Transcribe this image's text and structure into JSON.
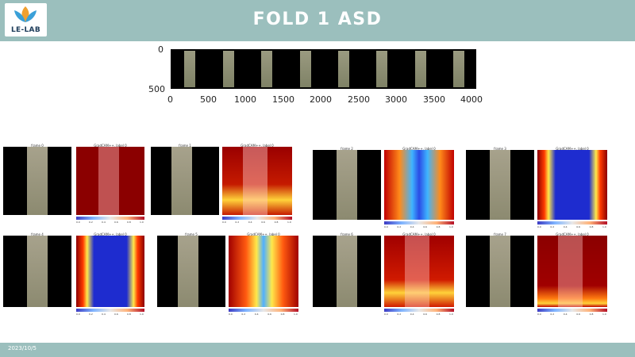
{
  "header": {
    "title": "FOLD 1 ASD",
    "logo_text": "LE-LAB"
  },
  "footer": {
    "date": "2023/10/5"
  },
  "strip": {
    "y_ticks": [
      "0",
      "500"
    ],
    "x_ticks": [
      "0",
      "500",
      "1000",
      "1500",
      "2000",
      "2500",
      "3000",
      "3500",
      "4000"
    ]
  },
  "gradcam": {
    "frame_titles": [
      "frame 0",
      "frame 1",
      "frame 2",
      "frame 3",
      "frame 4",
      "frame 5",
      "frame 6",
      "frame 7"
    ],
    "heatmap_title": "GradCAM++, label 0",
    "colorbar_ticks": [
      "0.0",
      "0.2",
      "0.4",
      "0.6",
      "0.8",
      "1.0"
    ]
  }
}
